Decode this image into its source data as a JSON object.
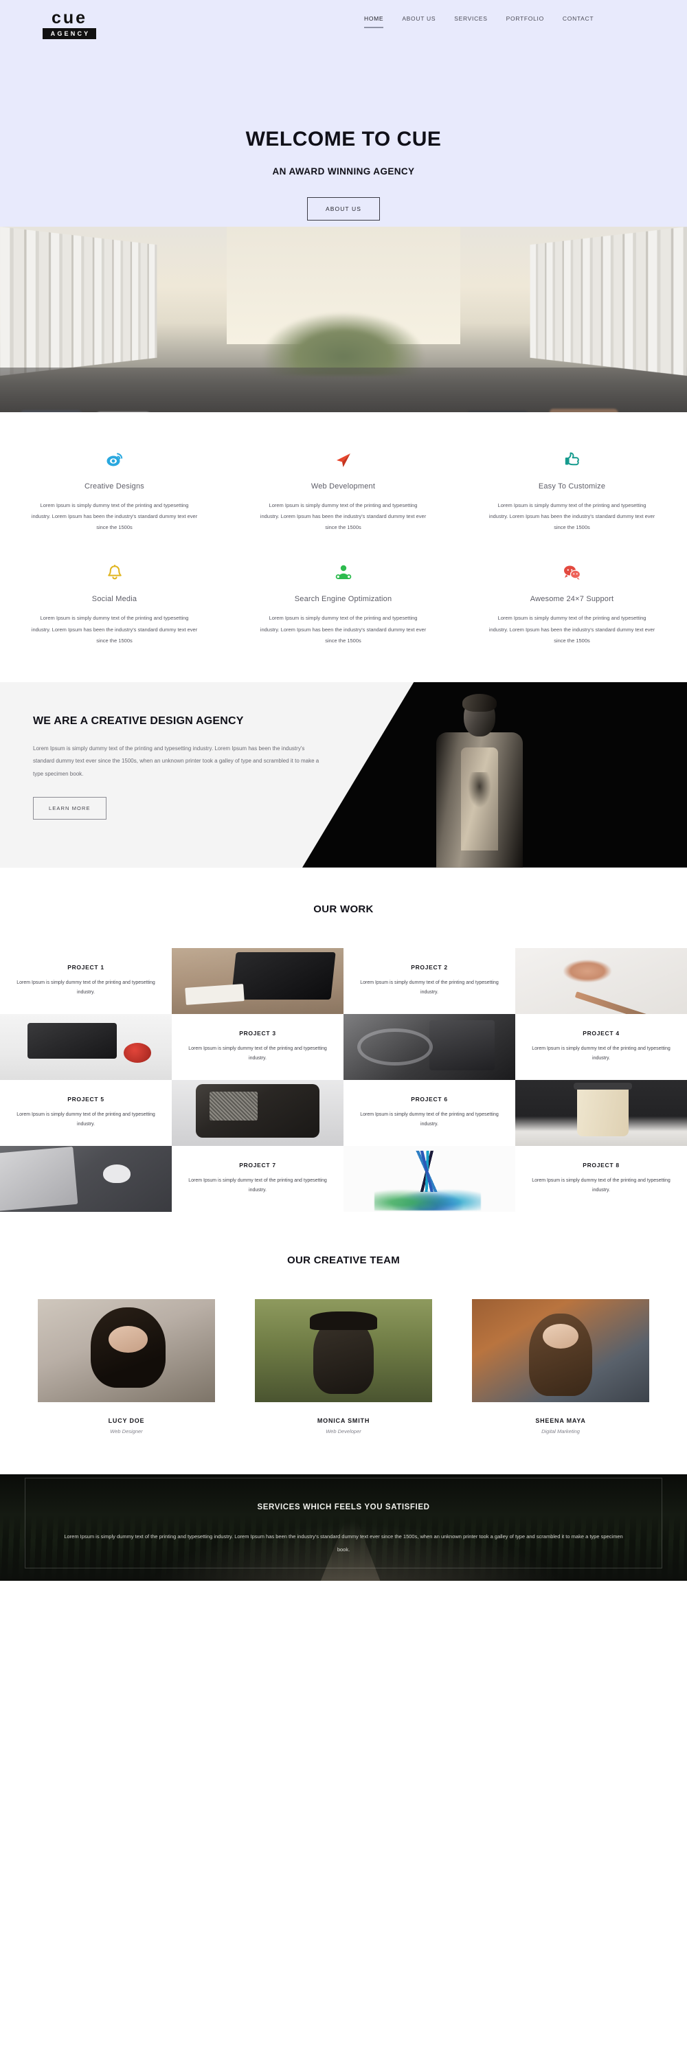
{
  "header": {
    "logo_word": "cue",
    "logo_sub": "AGENCY",
    "nav": [
      {
        "label": "HOME",
        "active": true
      },
      {
        "label": "ABOUT US",
        "active": false
      },
      {
        "label": "SERVICES",
        "active": false
      },
      {
        "label": "PORTFOLIO",
        "active": false
      },
      {
        "label": "CONTACT",
        "active": false
      }
    ]
  },
  "hero": {
    "title": "WELCOME TO CUE",
    "subtitle": "AN AWARD WINNING AGENCY",
    "button": "ABOUT US"
  },
  "features": [
    {
      "icon": "weibo-eye-icon",
      "color": "#29a8df",
      "title": "Creative Designs",
      "text": "Lorem Ipsum is simply dummy text of the printing and typesetting industry. Lorem Ipsum has been the industry's standard dummy text ever since the 1500s"
    },
    {
      "icon": "paper-plane-icon",
      "color": "#e8452c",
      "title": "Web Development",
      "text": "Lorem Ipsum is simply dummy text of the printing and typesetting industry. Lorem Ipsum has been the industry's standard dummy text ever since the 1500s"
    },
    {
      "icon": "thumbs-up-icon",
      "color": "#169b8e",
      "title": "Easy To Customize",
      "text": "Lorem Ipsum is simply dummy text of the printing and typesetting industry. Lorem Ipsum has been the industry's standard dummy text ever since the 1500s"
    },
    {
      "icon": "bell-icon",
      "color": "#e0b51f",
      "title": "Social Media",
      "text": "Lorem Ipsum is simply dummy text of the printing and typesetting industry. Lorem Ipsum has been the industry's standard dummy text ever since the 1500s"
    },
    {
      "icon": "user-support-icon",
      "color": "#2dbb4e",
      "title": "Search Engine Optimization",
      "text": "Lorem Ipsum is simply dummy text of the printing and typesetting industry. Lorem Ipsum has been the industry's standard dummy text ever since the 1500s"
    },
    {
      "icon": "chat-bubbles-icon",
      "color": "#e3493f",
      "title": "Awesome 24×7 Support",
      "text": "Lorem Ipsum is simply dummy text of the printing and typesetting industry. Lorem Ipsum has been the industry's standard dummy text ever since the 1500s"
    }
  ],
  "about": {
    "title": "WE ARE A CREATIVE DESIGN AGENCY",
    "text": "Lorem Ipsum is simply dummy text of the printing and typesetting industry. Lorem Ipsum has been the industry's standard dummy text ever since the 1500s, when an unknown printer took a galley of type and scrambled it to make a type specimen book.",
    "button": "LEARN MORE",
    "photo": "man-portrait-photo"
  },
  "work": {
    "title": "OUR WORK",
    "projects": [
      {
        "title": "PROJECT 1",
        "text": "Lorem Ipsum is simply dummy text of the printing and typesetting industry.",
        "photo": "laptop-on-wood-desk-photo"
      },
      {
        "title": "PROJECT 2",
        "text": "Lorem Ipsum is simply dummy text of the printing and typesetting industry.",
        "photo": "pencil-shavings-photo"
      },
      {
        "title": "PROJECT 3",
        "text": "Lorem Ipsum is simply dummy text of the printing and typesetting industry.",
        "photo": "laptop-apple-white-desk-photo"
      },
      {
        "title": "PROJECT 4",
        "text": "Lorem Ipsum is simply dummy text of the printing and typesetting industry.",
        "photo": "black-white-gadgets-photo"
      },
      {
        "title": "PROJECT 5",
        "text": "Lorem Ipsum is simply dummy text of the printing and typesetting industry.",
        "photo": "vintage-radio-photo"
      },
      {
        "title": "PROJECT 6",
        "text": "Lorem Ipsum is simply dummy text of the printing and typesetting industry.",
        "photo": "coffee-cup-bicycle-photo"
      },
      {
        "title": "PROJECT 7",
        "text": "Lorem Ipsum is simply dummy text of the printing and typesetting industry.",
        "photo": "desk-mouse-phone-photo"
      },
      {
        "title": "PROJECT 8",
        "text": "Lorem Ipsum is simply dummy text of the printing and typesetting industry.",
        "photo": "colored-pencils-splash-photo"
      }
    ]
  },
  "team": {
    "title": "OUR CREATIVE TEAM",
    "members": [
      {
        "name": "LUCY DOE",
        "role": "Web Designer",
        "photo": "lucy-doe-photo"
      },
      {
        "name": "MONICA SMITH",
        "role": "Web Developer",
        "photo": "monica-smith-photo"
      },
      {
        "name": "SHEENA MAYA",
        "role": "Digital Marketing",
        "photo": "sheena-maya-photo"
      }
    ]
  },
  "cta": {
    "title": "SERVICES WHICH FEELS YOU SATISFIED",
    "text": "Lorem Ipsum is simply dummy text of the printing and typesetting industry. Lorem Ipsum has been the industry's standard dummy text ever since the 1500s, when an unknown printer took a galley of type and scrambled it to make a type specimen book.",
    "background": "forest-boardwalk-photo"
  }
}
